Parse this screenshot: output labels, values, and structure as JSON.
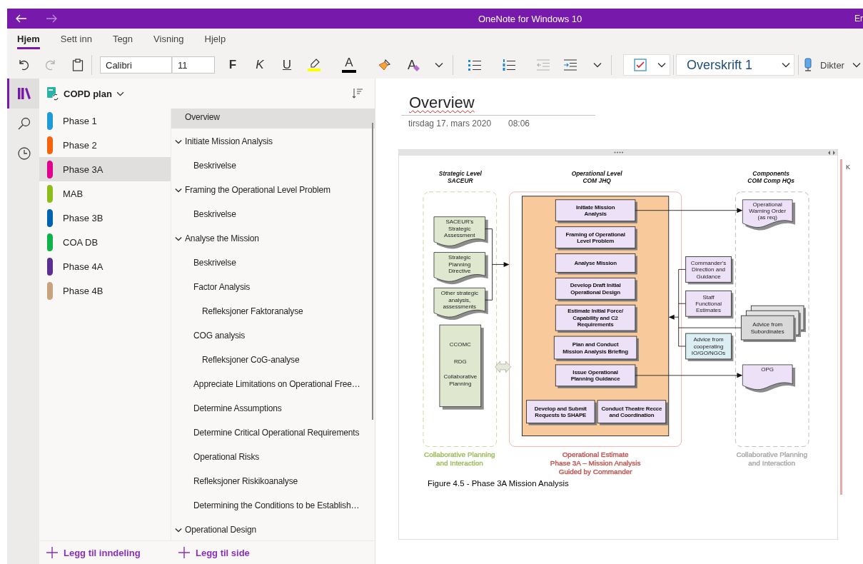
{
  "window": {
    "title": "OneNote for Windows 10",
    "account_label": "Er",
    "back_disabled": false,
    "forward_disabled": true
  },
  "ribbon_tabs": [
    {
      "label": "Hjem",
      "selected": true
    },
    {
      "label": "Sett inn",
      "selected": false
    },
    {
      "label": "Tegn",
      "selected": false
    },
    {
      "label": "Visning",
      "selected": false
    },
    {
      "label": "Hjelp",
      "selected": false
    }
  ],
  "toolbar": {
    "undo_disabled": false,
    "redo_disabled": true,
    "font_name": "Calibri",
    "font_size": "11",
    "bold": "F",
    "italic": "K",
    "underline": "U",
    "font_color": "A",
    "clear_formatting": "A",
    "outdent_disabled": true,
    "paragraph_style": "Overskrift 1",
    "dictate": "Dikter"
  },
  "rail": [
    {
      "kind": "notebooks",
      "selected": true
    },
    {
      "kind": "search",
      "selected": false
    },
    {
      "kind": "recent",
      "selected": false
    }
  ],
  "notebook": {
    "name": "COPD plan"
  },
  "sections": [
    {
      "name": "Phase 1",
      "color": "#1e9bd7",
      "selected": false
    },
    {
      "name": "Phase 2",
      "color": "#f7630c",
      "selected": false
    },
    {
      "name": "Phase 3A",
      "color": "#e3008c",
      "selected": true
    },
    {
      "name": "MAB",
      "color": "#8cbd18",
      "selected": false
    },
    {
      "name": "Phase 3B",
      "color": "#0063b1",
      "selected": false
    },
    {
      "name": "COA DB",
      "color": "#10b34a",
      "selected": false
    },
    {
      "name": "Phase 4A",
      "color": "#5c2e91",
      "selected": false
    },
    {
      "name": "Phase 4B",
      "color": "#c9a27e",
      "selected": false
    }
  ],
  "pages": [
    {
      "title": "Overview",
      "selected": true
    },
    {
      "title": "Initiate Mission Analysis",
      "selected": false,
      "expanded": true,
      "children": [
        {
          "title": "Beskrivelse",
          "selected": false
        }
      ]
    },
    {
      "title": "Framing the Operational Level Problem",
      "selected": false,
      "expanded": true,
      "children": [
        {
          "title": "Beskrivelse",
          "selected": false
        }
      ]
    },
    {
      "title": "Analyse the Mission",
      "selected": false,
      "expanded": true,
      "children": [
        {
          "title": "Beskrivelse",
          "selected": false
        },
        {
          "title": "Factor Analysis",
          "selected": false,
          "children": [
            {
              "title": "Refleksjoner Faktoranalyse",
              "selected": false
            }
          ]
        },
        {
          "title": "COG analysis",
          "selected": false,
          "children": [
            {
              "title": "Refleksjoner CoG-analyse",
              "selected": false
            }
          ]
        },
        {
          "title": "Appreciate Limitations on Operational Free…",
          "selected": false
        },
        {
          "title": "Determine Assumptions",
          "selected": false
        },
        {
          "title": "Determine Critical Operational Requirements",
          "selected": false
        },
        {
          "title": "Operational Risks",
          "selected": false
        },
        {
          "title": "Refleksjoner Riskikoanalyse",
          "selected": false
        },
        {
          "title": "Determining the Conditions to be Establish…",
          "selected": false
        }
      ]
    },
    {
      "title": "Operational Design",
      "selected": false,
      "expanded": true
    }
  ],
  "add_section": "Legg til inndeling",
  "add_page": "Legg til side",
  "page": {
    "title": "Overview",
    "date": "tirsdag 17. mars 2020",
    "time": "08:06"
  },
  "figure": {
    "headings": [
      {
        "lines": [
          "Strategic Level",
          "SACEUR"
        ]
      },
      {
        "lines": [
          "Operational Level",
          "COM JHQ"
        ]
      },
      {
        "lines": [
          "Components",
          "COM Comp HQs"
        ]
      }
    ],
    "strategic_inputs": [
      {
        "lines": [
          "SACEUR's",
          "Strategic",
          "Assessment"
        ]
      },
      {
        "lines": [
          "Strategic",
          "Planning",
          "Directive"
        ]
      },
      {
        "lines": [
          "Other strategic",
          "analysis,",
          "assessments"
        ]
      }
    ],
    "strategic_staff": {
      "lines": [
        "CCOMC",
        "RDG",
        "Collaborative",
        "Planning"
      ]
    },
    "steps": [
      {
        "lines": [
          "Initiate Mission",
          "Analysis"
        ]
      },
      {
        "lines": [
          "Framing of Operational",
          "Level Problem"
        ]
      },
      {
        "lines": [
          "Analyse Mission"
        ]
      },
      {
        "lines": [
          "Develop Draft Initial",
          "Operational Design"
        ]
      },
      {
        "lines": [
          "Estimate Initial Force/",
          "Capability and C2",
          "Requirements"
        ]
      },
      {
        "lines": [
          "Plan and Conduct",
          "Mission Analysis Briefing"
        ]
      },
      {
        "lines": [
          "Issue Operational",
          "Planning Guidance"
        ]
      },
      {
        "lines": [
          "Develop and Submit",
          "Requests to SHAPE"
        ]
      },
      {
        "lines": [
          "Conduct Theatre Recce",
          "and Coordination"
        ]
      }
    ],
    "staff_inputs": [
      {
        "kind": "internal",
        "lines": [
          "Commander's",
          "Direction and",
          "Guidance"
        ]
      },
      {
        "kind": "internal",
        "lines": [
          "Staff",
          "Functional",
          "Estimates"
        ]
      },
      {
        "kind": "external",
        "lines": [
          "Advice from",
          "cooperating",
          "IO/GO/NGOs"
        ]
      }
    ],
    "component_outputs": [
      {
        "lines": [
          "Operational",
          "Warning Order",
          "(as req)"
        ]
      },
      {
        "lines": [
          "OPG"
        ]
      }
    ],
    "subordinate_advice": {
      "lines": [
        "Advice from",
        "Subordinates"
      ]
    },
    "captions": [
      {
        "lines": [
          "Collaborative Planning",
          "and Interaction"
        ],
        "color": "#9bbb59"
      },
      {
        "lines": [
          "Operational Estimate",
          "Phase 3A – Mission Analysis",
          "Guided by Commander"
        ],
        "color": "#c0504d"
      },
      {
        "lines": [
          "Collaborative Planning",
          "and Interaction"
        ],
        "color": "#a6a6a6"
      }
    ],
    "caption": "Figure 4.5 - Phase 3A Mission Analysis"
  },
  "note_text": "K"
}
